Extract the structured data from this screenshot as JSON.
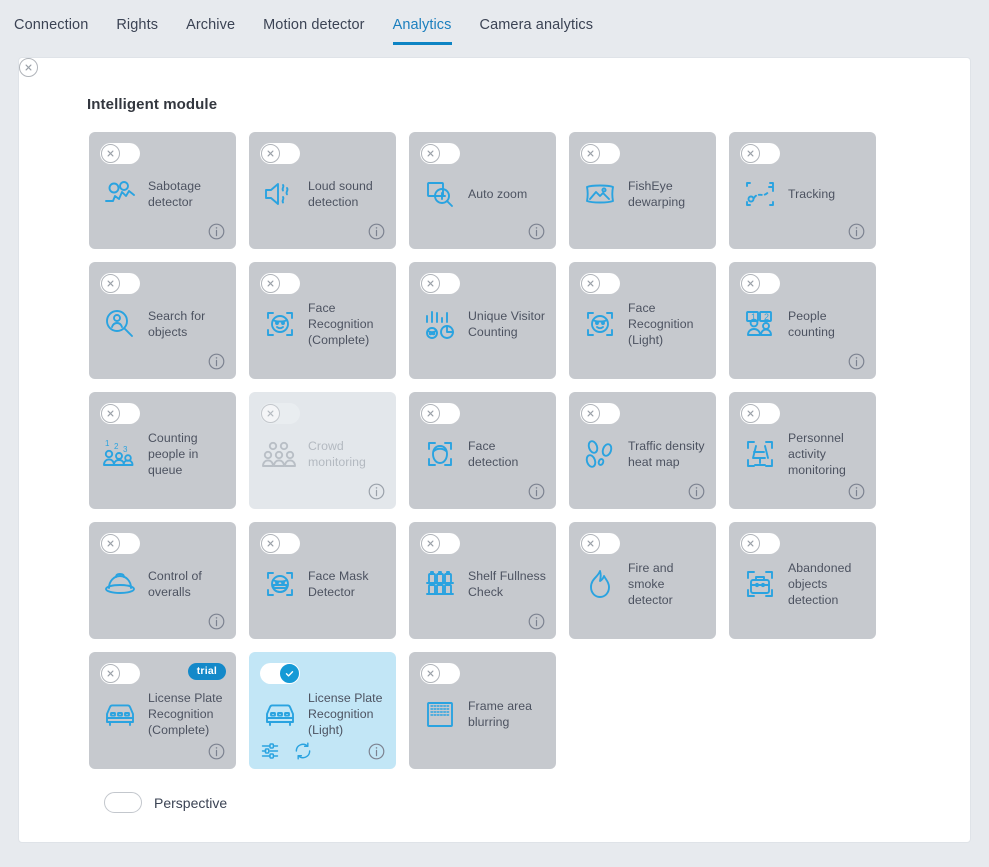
{
  "tabs": [
    {
      "label": "Connection",
      "active": false
    },
    {
      "label": "Rights",
      "active": false
    },
    {
      "label": "Archive",
      "active": false
    },
    {
      "label": "Motion detector",
      "active": false
    },
    {
      "label": "Analytics",
      "active": true
    },
    {
      "label": "Camera analytics",
      "active": false
    }
  ],
  "section": {
    "title": "Intelligent module"
  },
  "colors": {
    "accent": "#0d84c4",
    "icon_blue": "#2aa3e0",
    "card_bg": "#c6c9ce",
    "card_active_bg": "#c2e6f6",
    "card_disabled_bg": "#e3e7eb",
    "trial_badge": "#1489c9",
    "page_bg": "#e7eaee"
  },
  "modules": [
    {
      "label": "Sabotage detector",
      "icon": "sabotage-icon",
      "state": "off",
      "info": true,
      "trial": false,
      "tools": false
    },
    {
      "label": "Loud sound detection",
      "icon": "loud-sound-icon",
      "state": "off",
      "info": true,
      "trial": false,
      "tools": false
    },
    {
      "label": "Auto zoom",
      "icon": "auto-zoom-icon",
      "state": "off",
      "info": true,
      "trial": false,
      "tools": false
    },
    {
      "label": "FishEye dewarping",
      "icon": "fisheye-icon",
      "state": "off",
      "info": false,
      "trial": false,
      "tools": false
    },
    {
      "label": "Tracking",
      "icon": "tracking-icon",
      "state": "off",
      "info": true,
      "trial": false,
      "tools": false
    },
    {
      "label": "Search for objects",
      "icon": "search-person-icon",
      "state": "off",
      "info": true,
      "trial": false,
      "tools": false
    },
    {
      "label": "Face Recognition (Complete)",
      "icon": "face-frame-icon",
      "state": "off",
      "info": false,
      "trial": false,
      "tools": false
    },
    {
      "label": "Unique Visitor Counting",
      "icon": "visitor-chart-icon",
      "state": "off",
      "info": false,
      "trial": false,
      "tools": false
    },
    {
      "label": "Face Recognition (Light)",
      "icon": "face-frame-icon",
      "state": "off",
      "info": false,
      "trial": false,
      "tools": false
    },
    {
      "label": "People counting",
      "icon": "people-count-icon",
      "state": "off",
      "info": true,
      "trial": false,
      "tools": false
    },
    {
      "label": "Counting people in queue",
      "icon": "queue-count-icon",
      "state": "off",
      "info": false,
      "trial": false,
      "tools": false
    },
    {
      "label": "Crowd monitoring",
      "icon": "crowd-icon",
      "state": "disabled",
      "info": true,
      "trial": false,
      "tools": false
    },
    {
      "label": "Face detection",
      "icon": "face-detect-icon",
      "state": "off",
      "info": true,
      "trial": false,
      "tools": false
    },
    {
      "label": "Traffic density heat map",
      "icon": "footprints-icon",
      "state": "off",
      "info": true,
      "trial": false,
      "tools": false
    },
    {
      "label": "Personnel activity monitoring",
      "icon": "chair-frame-icon",
      "state": "off",
      "info": true,
      "trial": false,
      "tools": false
    },
    {
      "label": "Control of overalls",
      "icon": "helmet-icon",
      "state": "off",
      "info": true,
      "trial": false,
      "tools": false
    },
    {
      "label": "Face Mask Detector",
      "icon": "face-mask-icon",
      "state": "off",
      "info": false,
      "trial": false,
      "tools": false
    },
    {
      "label": "Shelf Fullness Check",
      "icon": "shelf-icon",
      "state": "off",
      "info": true,
      "trial": false,
      "tools": false
    },
    {
      "label": "Fire and smoke detector",
      "icon": "flame-icon",
      "state": "off",
      "info": false,
      "trial": false,
      "tools": false
    },
    {
      "label": "Abandoned objects detection",
      "icon": "suitcase-frame-icon",
      "state": "off",
      "info": false,
      "trial": false,
      "tools": false
    },
    {
      "label": "License Plate Recognition (Complete)",
      "icon": "car-plate-icon",
      "state": "off",
      "info": true,
      "trial": true,
      "tools": false
    },
    {
      "label": "License Plate Recognition (Light)",
      "icon": "car-plate-icon",
      "state": "on",
      "info": true,
      "trial": false,
      "tools": true
    },
    {
      "label": "Frame area blurring",
      "icon": "blur-area-icon",
      "state": "off",
      "info": false,
      "trial": false,
      "tools": false
    }
  ],
  "trial_badge_label": "trial",
  "perspective": {
    "label": "Perspective",
    "state": "off"
  },
  "tool_icons": {
    "settings": "settings-sliders-icon",
    "refresh": "refresh-icon",
    "info": "info-icon"
  }
}
